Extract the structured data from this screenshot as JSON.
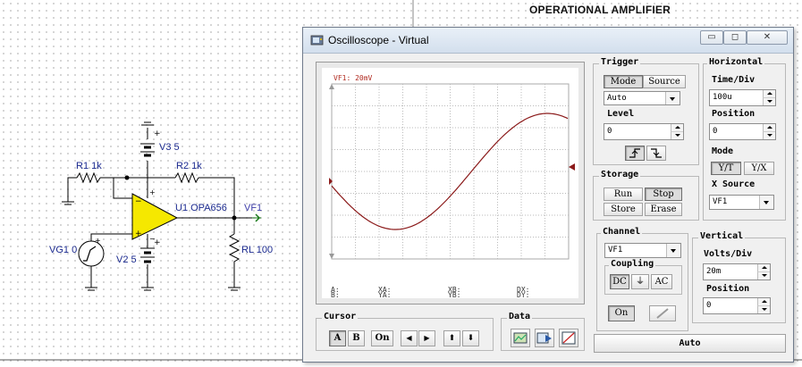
{
  "document": {
    "title": "OPERATIONAL AMPLIFIER"
  },
  "schematic": {
    "components": {
      "r1": "R1 1k",
      "r2": "R2 1k",
      "v3": "V3 5",
      "v2": "V2 5",
      "u1": "U1 OPA656",
      "vg1": "VG1 0",
      "rl": "RL 100",
      "vf1": "VF1"
    }
  },
  "oscilloscope": {
    "title": "Oscilloscope - Virtual",
    "window_buttons": {
      "minimize": "▭",
      "maximize": "◻",
      "close": "✕"
    },
    "screen": {
      "channel_label": "VF1: 20mV",
      "trace_color": "#8b1a1a",
      "cursor_readouts": [
        [
          "A:",
          "XA:",
          "XB:",
          "DX:"
        ],
        [
          "B:",
          "YA:",
          "YB:",
          "DY:"
        ]
      ]
    },
    "trigger": {
      "title": "Trigger",
      "mode_label": "Mode",
      "source_label": "Source",
      "mode_value": "Auto",
      "level_label": "Level",
      "level_value": "0",
      "edge_rising_icon": "rising-edge-icon",
      "edge_falling_icon": "falling-edge-icon"
    },
    "horizontal": {
      "title": "Horizontal",
      "time_div_label": "Time/Div",
      "time_div_value": "100u",
      "position_label": "Position",
      "position_value": "0",
      "mode_label": "Mode",
      "mode_yt": "Y/T",
      "mode_yx": "Y/X",
      "x_source_label": "X Source",
      "x_source_value": "VF1"
    },
    "storage": {
      "title": "Storage",
      "run": "Run",
      "stop": "Stop",
      "store": "Store",
      "erase": "Erase"
    },
    "channel": {
      "title": "Channel",
      "value": "VF1",
      "coupling_title": "Coupling",
      "dc": "DC",
      "ground_glyph": "⏚",
      "ac": "AC",
      "on": "On"
    },
    "vertical": {
      "title": "Vertical",
      "volts_div_label": "Volts/Div",
      "volts_div_value": "20m",
      "position_label": "Position",
      "position_value": "0"
    },
    "cursor": {
      "title": "Cursor",
      "a": "A",
      "b": "B",
      "on": "On",
      "left": "◀",
      "right": "▶",
      "up": "⬆",
      "down": "⬇"
    },
    "data": {
      "title": "Data"
    },
    "auto_button": "Auto"
  }
}
